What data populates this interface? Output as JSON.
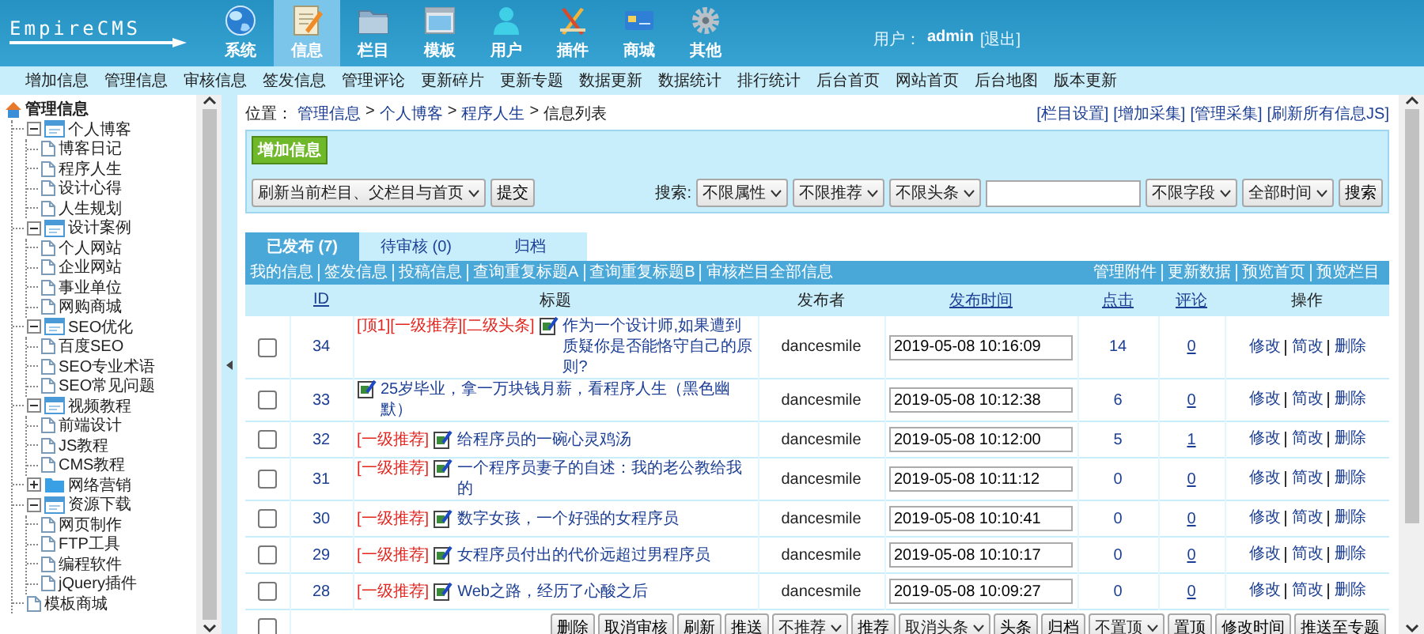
{
  "header": {
    "logo": "EmpireCMS",
    "nav": [
      {
        "label": "系统",
        "selected": false
      },
      {
        "label": "信息",
        "selected": true
      },
      {
        "label": "栏目",
        "selected": false
      },
      {
        "label": "模板",
        "selected": false
      },
      {
        "label": "用户",
        "selected": false
      },
      {
        "label": "插件",
        "selected": false
      },
      {
        "label": "商城",
        "selected": false
      },
      {
        "label": "其他",
        "selected": false
      }
    ],
    "user": {
      "label": "用户：",
      "name": "admin",
      "logout": "[退出]"
    }
  },
  "menu": [
    "增加信息",
    "管理信息",
    "审核信息",
    "签发信息",
    "管理评论",
    "更新碎片",
    "更新专题",
    "数据更新",
    "数据统计",
    "排行统计",
    "后台首页",
    "网站首页",
    "后台地图",
    "版本更新"
  ],
  "sidebar": {
    "title": "管理信息",
    "items": [
      {
        "label": "个人博客",
        "kind": "folder",
        "expanded": true,
        "children": [
          {
            "label": "博客日记"
          },
          {
            "label": "程序人生"
          },
          {
            "label": "设计心得"
          },
          {
            "label": "人生规划"
          }
        ]
      },
      {
        "label": "设计案例",
        "kind": "folder",
        "expanded": true,
        "children": [
          {
            "label": "个人网站"
          },
          {
            "label": "企业网站"
          },
          {
            "label": "事业单位"
          },
          {
            "label": "网购商城"
          }
        ]
      },
      {
        "label": "SEO优化",
        "kind": "folder",
        "expanded": true,
        "children": [
          {
            "label": "百度SEO"
          },
          {
            "label": "SEO专业术语"
          },
          {
            "label": "SEO常见问题"
          }
        ]
      },
      {
        "label": "视频教程",
        "kind": "folder",
        "expanded": true,
        "children": [
          {
            "label": "前端设计"
          },
          {
            "label": "JS教程"
          },
          {
            "label": "CMS教程"
          }
        ]
      },
      {
        "label": "网络营销",
        "kind": "folder",
        "expanded": false
      },
      {
        "label": "资源下载",
        "kind": "folder",
        "expanded": true,
        "children": [
          {
            "label": "网页制作"
          },
          {
            "label": "FTP工具"
          },
          {
            "label": "编程软件"
          },
          {
            "label": "jQuery插件"
          }
        ]
      },
      {
        "label": "模板商城",
        "kind": "page"
      }
    ]
  },
  "breadcrumb": {
    "label": "位置：",
    "separator": ">",
    "items": [
      "管理信息",
      "个人博客",
      "程序人生",
      "信息列表"
    ],
    "actions": [
      "[栏目设置]",
      "[增加采集]",
      "[管理采集]",
      "[刷新所有信息JS]"
    ]
  },
  "panel": {
    "add_button": "增加信息",
    "refresh_select": "刷新当前栏目、父栏目与首页",
    "submit": "提交",
    "search": {
      "label": "搜索:",
      "controls": [
        {
          "kind": "select",
          "label": "不限属性"
        },
        {
          "kind": "select",
          "label": "不限推荐"
        },
        {
          "kind": "select",
          "label": "不限头条"
        },
        {
          "kind": "input"
        },
        {
          "kind": "select",
          "label": "不限字段"
        },
        {
          "kind": "select",
          "label": "全部时间"
        },
        {
          "kind": "button",
          "label": "搜索"
        }
      ]
    }
  },
  "tabs": [
    {
      "label": "已发布 (7)",
      "selected": true
    },
    {
      "label": "待审核 (0)",
      "selected": false
    },
    {
      "label": "归档",
      "selected": false
    }
  ],
  "link_bar": {
    "left": [
      "我的信息",
      "签发信息",
      "投稿信息",
      "查询重复标题A",
      "查询重复标题B",
      "审核栏目全部信息"
    ],
    "right": [
      "管理附件",
      "更新数据",
      "预览首页",
      "预览栏目"
    ]
  },
  "table": {
    "columns": [
      {
        "label": "ID",
        "sortable": true
      },
      {
        "label": "标题",
        "sortable": false
      },
      {
        "label": "发布者",
        "sortable": false
      },
      {
        "label": "发布时间",
        "sortable": true
      },
      {
        "label": "点击",
        "sortable": true
      },
      {
        "label": "评论",
        "sortable": true
      },
      {
        "label": "操作",
        "sortable": false
      }
    ],
    "rows": [
      {
        "checked": false,
        "id": "34",
        "flags": "[顶1][一级推荐][二级头条]",
        "title": "作为一个设计师,如果遭到质疑你是否能恪守自己的原则?",
        "author": "dancesmile",
        "time": "2019-05-08 10:16:09",
        "clicks": "14",
        "comments": "0",
        "actions": [
          "修改",
          "简改",
          "删除"
        ]
      },
      {
        "checked": false,
        "id": "33",
        "title": "25岁毕业，拿一万块钱月薪，看程序人生（黑色幽默）",
        "author": "dancesmile",
        "time": "2019-05-08 10:12:38",
        "clicks": "6",
        "comments": "0",
        "actions": [
          "修改",
          "简改",
          "删除"
        ]
      },
      {
        "checked": false,
        "id": "32",
        "flags": "[一级推荐]",
        "title": "给程序员的一碗心灵鸡汤",
        "author": "dancesmile",
        "time": "2019-05-08 10:12:00",
        "clicks": "5",
        "comments": "1",
        "actions": [
          "修改",
          "简改",
          "删除"
        ]
      },
      {
        "checked": false,
        "id": "31",
        "flags": "[一级推荐]",
        "title": "一个程序员妻子的自述：我的老公教给我的",
        "author": "dancesmile",
        "time": "2019-05-08 10:11:12",
        "clicks": "0",
        "comments": "0",
        "actions": [
          "修改",
          "简改",
          "删除"
        ]
      },
      {
        "checked": false,
        "id": "30",
        "flags": "[一级推荐]",
        "title": "数字女孩，一个好强的女程序员",
        "author": "dancesmile",
        "time": "2019-05-08 10:10:41",
        "clicks": "0",
        "comments": "0",
        "actions": [
          "修改",
          "简改",
          "删除"
        ]
      },
      {
        "checked": false,
        "id": "29",
        "flags": "[一级推荐]",
        "title": "女程序员付出的代价远超过男程序员",
        "author": "dancesmile",
        "time": "2019-05-08 10:10:17",
        "clicks": "0",
        "comments": "0",
        "actions": [
          "修改",
          "简改",
          "删除"
        ]
      },
      {
        "checked": false,
        "id": "28",
        "flags": "[一级推荐]",
        "title": "Web之路，经历了心酸之后",
        "author": "dancesmile",
        "time": "2019-05-08 10:09:27",
        "clicks": "0",
        "comments": "0",
        "actions": [
          "修改",
          "简改",
          "删除"
        ]
      }
    ],
    "footer": {
      "select_all": {
        "checked": false
      },
      "controls": [
        {
          "kind": "button",
          "label": "删除"
        },
        {
          "kind": "button",
          "label": "取消审核"
        },
        {
          "kind": "button",
          "label": "刷新"
        },
        {
          "kind": "button",
          "label": "推送"
        },
        {
          "kind": "select",
          "label": "不推荐"
        },
        {
          "kind": "button",
          "label": "推荐"
        },
        {
          "kind": "select",
          "label": "取消头条"
        },
        {
          "kind": "button",
          "label": "头条"
        },
        {
          "kind": "button",
          "label": "归档"
        },
        {
          "kind": "select",
          "label": "不置顶"
        },
        {
          "kind": "button",
          "label": "置顶"
        },
        {
          "kind": "button",
          "label": "修改时间"
        },
        {
          "kind": "button",
          "label": "推送至专题"
        }
      ]
    }
  }
}
